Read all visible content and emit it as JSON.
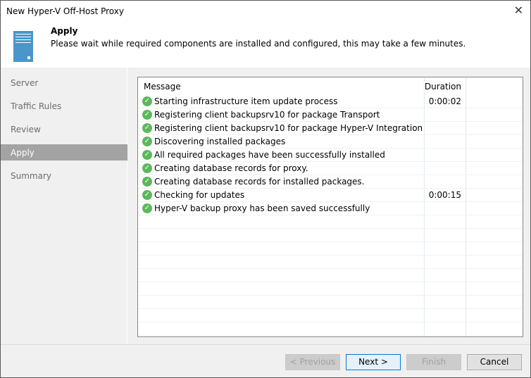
{
  "window": {
    "title": "New Hyper-V Off-Host Proxy",
    "close_label": "✕"
  },
  "header": {
    "title": "Apply",
    "description": "Please wait while required components are installed and configured, this may take a few minutes."
  },
  "sidebar": {
    "items": [
      {
        "label": "Server"
      },
      {
        "label": "Traffic Rules"
      },
      {
        "label": "Review"
      },
      {
        "label": "Apply",
        "active": true
      },
      {
        "label": "Summary"
      }
    ]
  },
  "table": {
    "columns": [
      "Message",
      "Duration"
    ],
    "rows": [
      {
        "message": "Starting infrastructure item update process",
        "duration": "0:00:02",
        "status": "success"
      },
      {
        "message": "Registering client backupsrv10 for package Transport",
        "duration": "",
        "status": "success"
      },
      {
        "message": "Registering client backupsrv10 for package Hyper-V Integration",
        "duration": "",
        "status": "success"
      },
      {
        "message": "Discovering installed packages",
        "duration": "",
        "status": "success"
      },
      {
        "message": "All required packages have been successfully installed",
        "duration": "",
        "status": "success"
      },
      {
        "message": "Creating database records for proxy.",
        "duration": "",
        "status": "success"
      },
      {
        "message": "Creating database records for installed packages.",
        "duration": "",
        "status": "success"
      },
      {
        "message": "Checking for updates",
        "duration": "0:00:15",
        "status": "success"
      },
      {
        "message": "Hyper-V backup proxy has been saved successfully",
        "duration": "",
        "status": "success"
      }
    ]
  },
  "buttons": {
    "previous": "< Previous",
    "next": "Next >",
    "finish": "Finish",
    "cancel": "Cancel"
  },
  "colors": {
    "success": "#5cb85c",
    "accent": "#0078d7",
    "selected_nav": "#a3a3a3"
  }
}
